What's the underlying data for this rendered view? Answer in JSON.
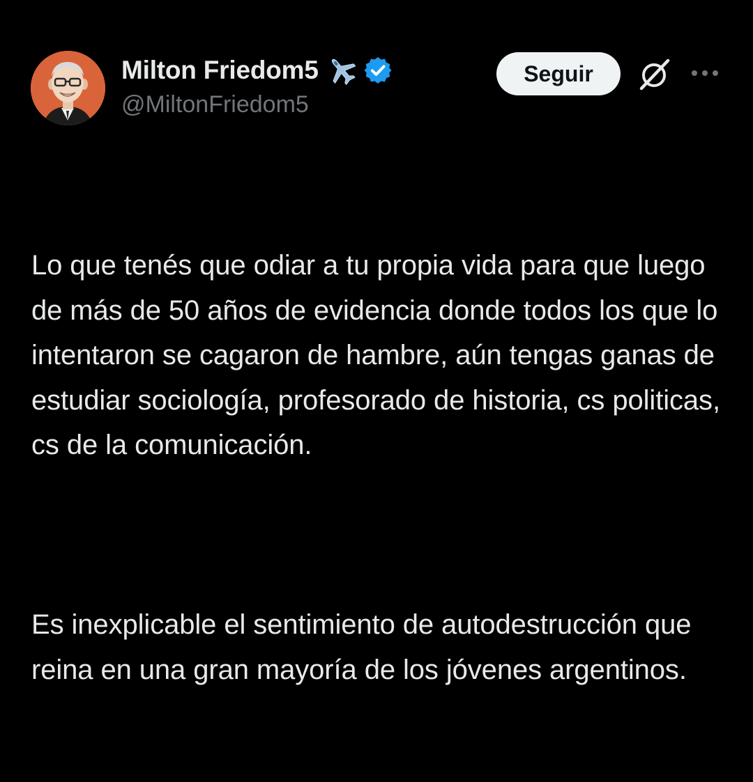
{
  "tweet": {
    "author": {
      "display_name": "Milton Friedom5",
      "handle": "@MiltonFriedom5",
      "avatar": "avatar-portrait",
      "badges": [
        "airplane-icon",
        "verified-badge-icon"
      ],
      "verified_color": "#1d9bf0"
    },
    "follow_label": "Seguir",
    "actions": [
      "grok-icon",
      "more-options-icon"
    ],
    "paragraphs": [
      "Lo que tenés que odiar a tu propia vida para que luego de más de 50 años de evidencia donde todos los que lo intentaron se cagaron de hambre, aún tengas ganas de estudiar sociología, profesorado de historia, cs politicas, cs de la comunicación.",
      "Es inexplicable el sentimiento de autodestrucción que reina en una gran mayoría de los jóvenes argentinos."
    ]
  },
  "colors": {
    "background": "#000000",
    "text_primary": "#e7e9ea",
    "text_secondary": "#71767b",
    "button_bg": "#eff3f4",
    "button_text": "#0f1419"
  }
}
